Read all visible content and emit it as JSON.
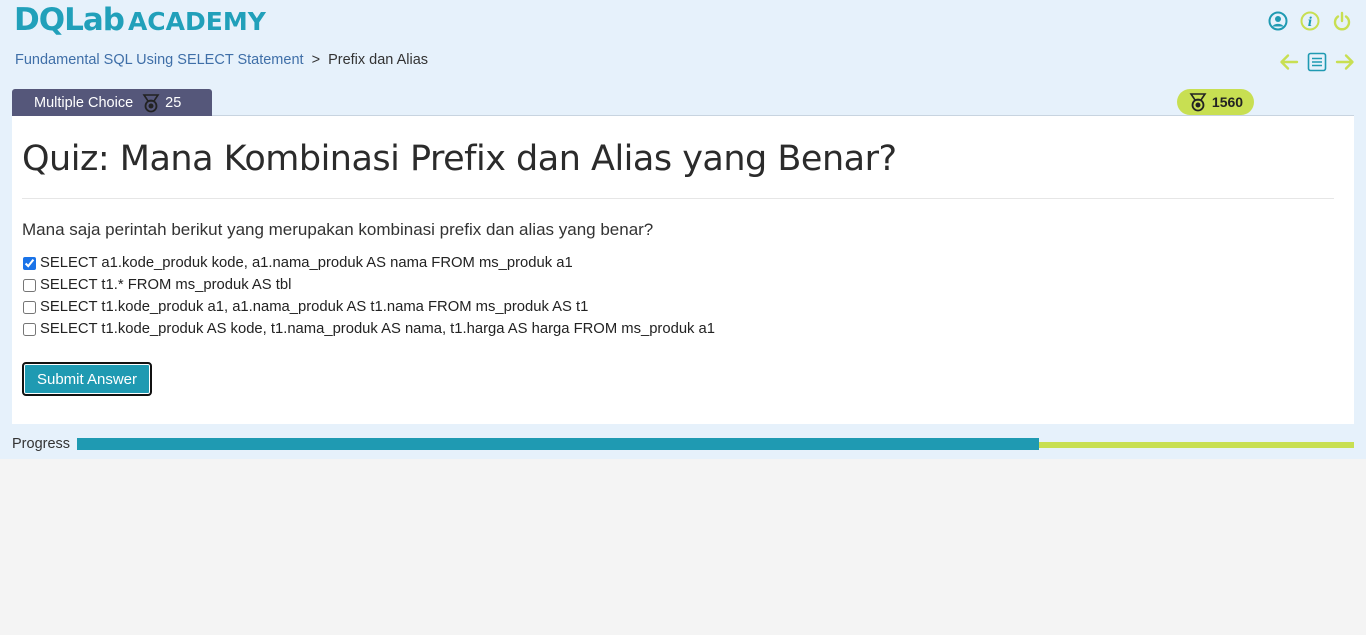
{
  "brand": {
    "main": "DQLab",
    "academy": "ACADEMY",
    "color": "#21a0ba"
  },
  "header_icons": [
    "user-icon",
    "info-icon",
    "power-icon"
  ],
  "breadcrumb": {
    "parent": "Fundamental SQL Using SELECT Statement",
    "separator": ">",
    "current": "Prefix dan Alias"
  },
  "nav_icons": [
    "arrow-left-icon",
    "list-icon",
    "arrow-right-icon"
  ],
  "tab": {
    "label": "Multiple Choice",
    "points": "25"
  },
  "total_points": "1560",
  "quiz": {
    "title": "Quiz: Mana Kombinasi Prefix dan Alias yang Benar?",
    "question": "Mana saja perintah berikut yang merupakan kombinasi prefix dan alias yang benar?",
    "options": [
      {
        "label": "SELECT a1.kode_produk kode, a1.nama_produk AS nama FROM ms_produk a1",
        "checked": true
      },
      {
        "label": "SELECT t1.* FROM ms_produk AS tbl",
        "checked": false
      },
      {
        "label": "SELECT t1.kode_produk a1, a1.nama_produk AS t1.nama FROM ms_produk AS t1",
        "checked": false
      },
      {
        "label": "SELECT t1.kode_produk AS kode, t1.nama_produk AS nama, t1.harga AS harga FROM ms_produk a1",
        "checked": false
      }
    ],
    "submit_label": "Submit Answer"
  },
  "progress": {
    "label": "Progress",
    "fraction": 0.753
  },
  "colors": {
    "teal": "#1f9ab2",
    "lime": "#c8df52",
    "tab": "#55577a",
    "link": "#3f6fa8"
  }
}
